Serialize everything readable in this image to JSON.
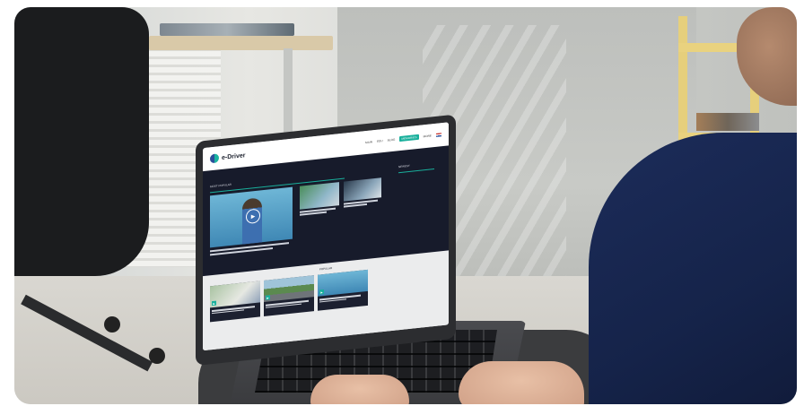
{
  "site": {
    "logo_text": "e-Driver",
    "nav": [
      "MAIN",
      "EDU",
      "BLOG",
      "MEMORIES",
      "MORE"
    ]
  },
  "hero": {
    "section_label": "MOST POPULAR",
    "side_label": "NEWEST"
  },
  "popular": {
    "section_label": "POPULAR"
  },
  "colors": {
    "accent": "#19b09c",
    "dark_band": "#171b2b",
    "brand_blue": "#2a4f9a"
  }
}
